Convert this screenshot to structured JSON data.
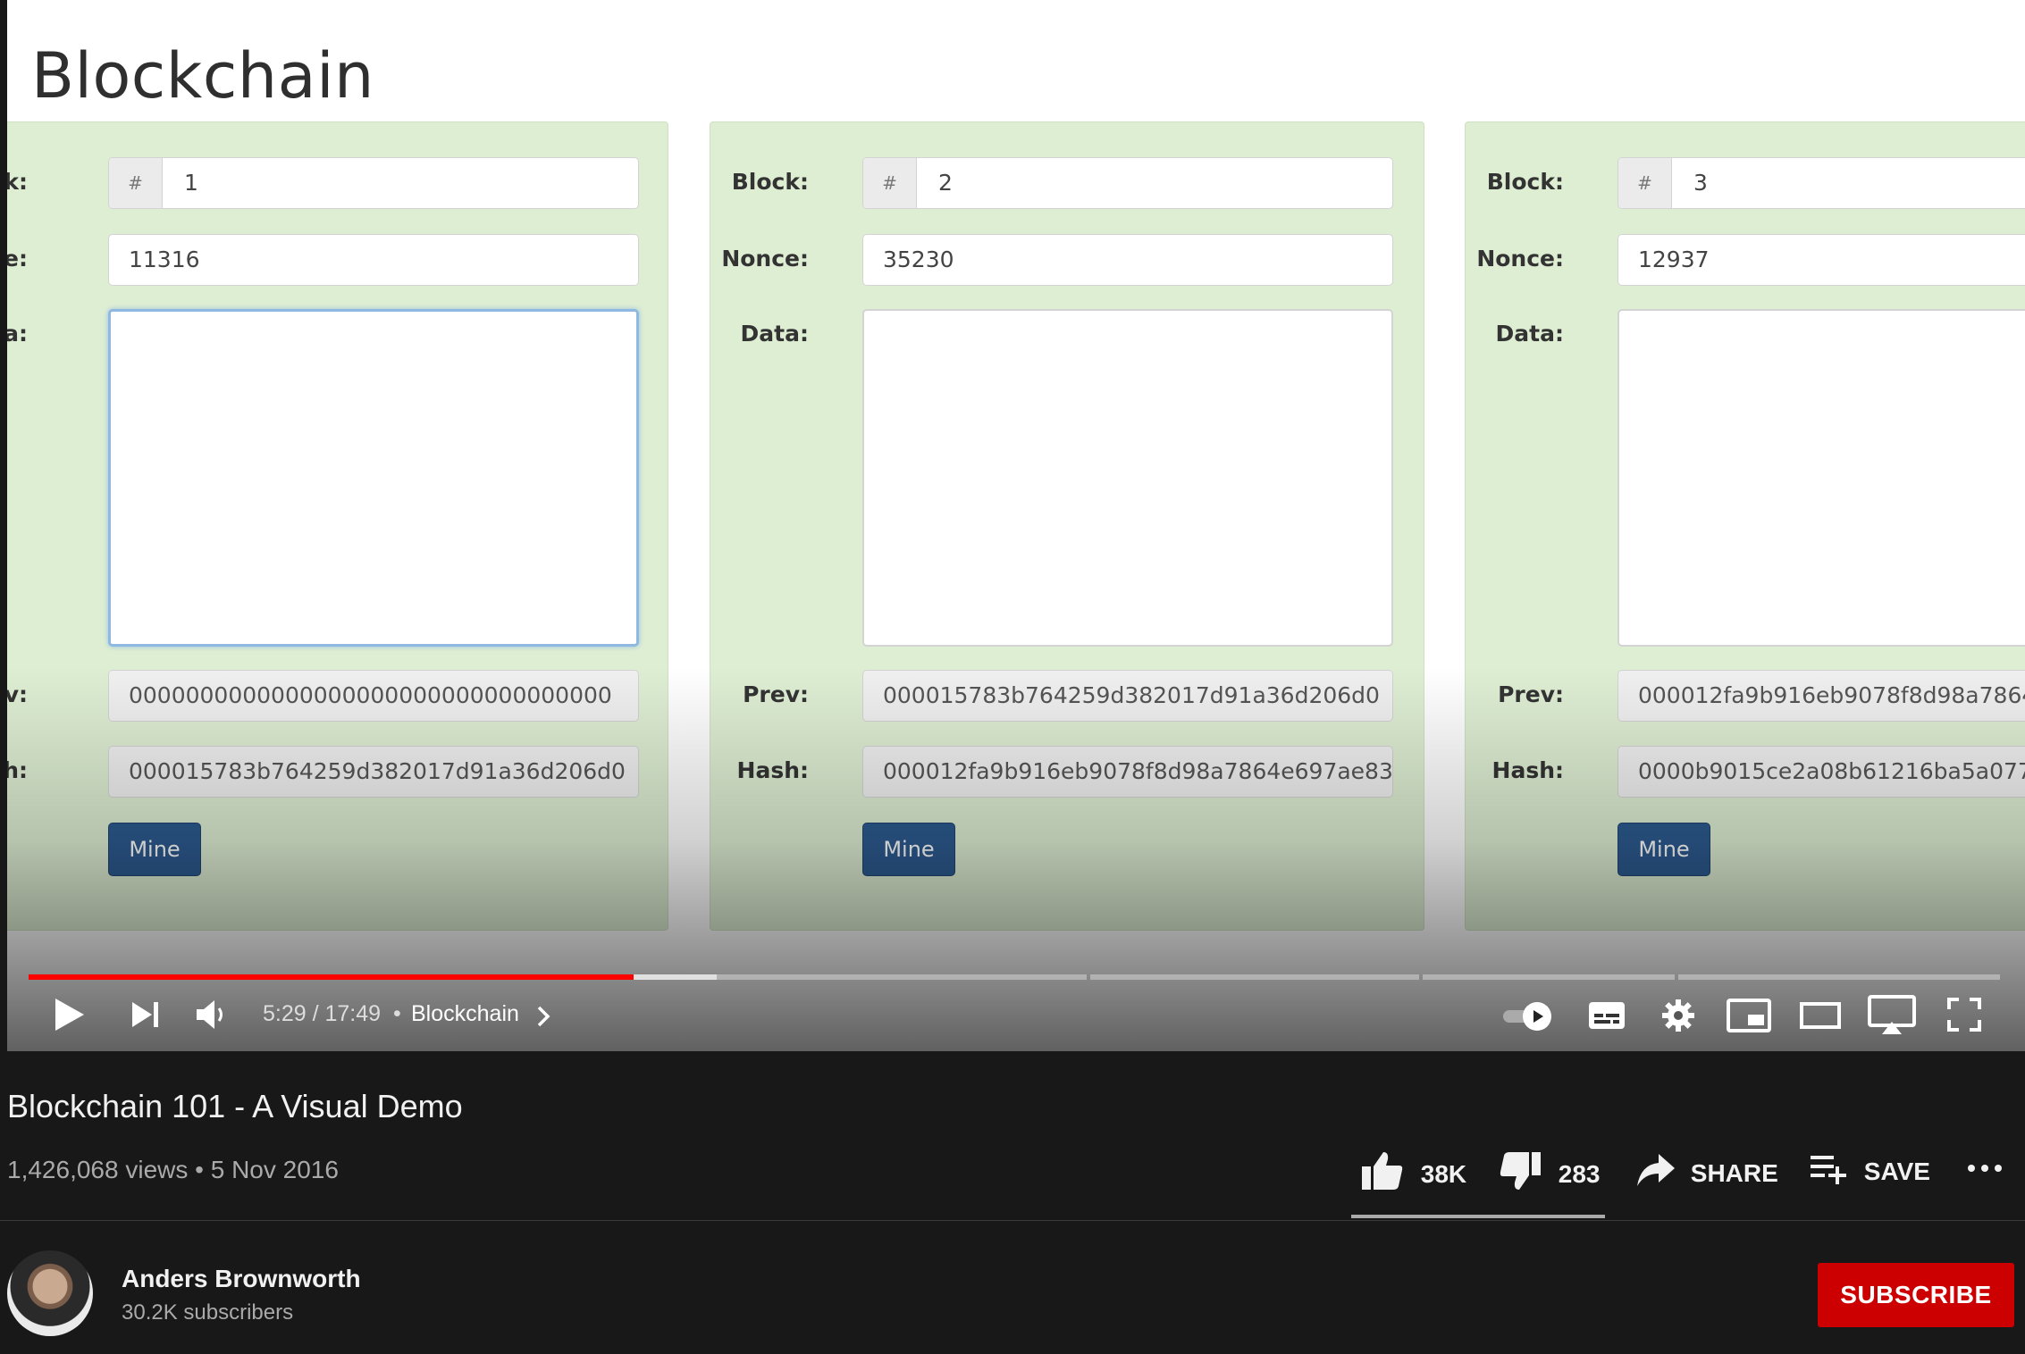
{
  "video_frame": {
    "page_title": "Blockchain",
    "labels": {
      "block": "Block:",
      "nonce": "Nonce:",
      "data": "Data:",
      "prev": "Prev:",
      "hash": "Hash:"
    },
    "labels_clipped": {
      "block": "ock:",
      "nonce": "once:",
      "data": "ata:",
      "prev": "rev:",
      "hash": "ash:"
    },
    "hash_addon": "#",
    "mine_label": "Mine",
    "blocks": [
      {
        "number": "1",
        "nonce": "11316",
        "data": "",
        "prev": "0000000000000000000000000000000000",
        "hash": "000015783b764259d382017d91a36d206d0"
      },
      {
        "number": "2",
        "nonce": "35230",
        "data": "",
        "prev": "000015783b764259d382017d91a36d206d0",
        "hash": "000012fa9b916eb9078f8d98a7864e697ae83"
      },
      {
        "number": "3",
        "nonce": "12937",
        "data": "",
        "prev": "000012fa9b916eb9078f8d98a7864",
        "hash": "0000b9015ce2a08b61216ba5a077"
      }
    ]
  },
  "player": {
    "time": "5:29 / 17:49",
    "separator": "•",
    "chapter": "Blockchain",
    "progress_fraction": 0.307,
    "icons": [
      "play-icon",
      "next-icon",
      "volume-icon",
      "autoplay-toggle-icon",
      "subtitles-icon",
      "settings-icon",
      "miniplayer-icon",
      "theater-icon",
      "cast-icon",
      "fullscreen-icon"
    ]
  },
  "video_info": {
    "title": "Blockchain 101 - A Visual Demo",
    "views": "1,426,068 views • 5 Nov 2016",
    "likes": "38K",
    "dislikes": "283",
    "share": "SHARE",
    "save": "SAVE"
  },
  "channel": {
    "name": "Anders Brownworth",
    "subscribers": "30.2K subscribers",
    "subscribe_label": "SUBSCRIBE"
  },
  "colors": {
    "accent": "#ff0000",
    "subscribe": "#cc0000",
    "block_bg": "#deeed3",
    "mine_button": "#2c5a8f"
  }
}
